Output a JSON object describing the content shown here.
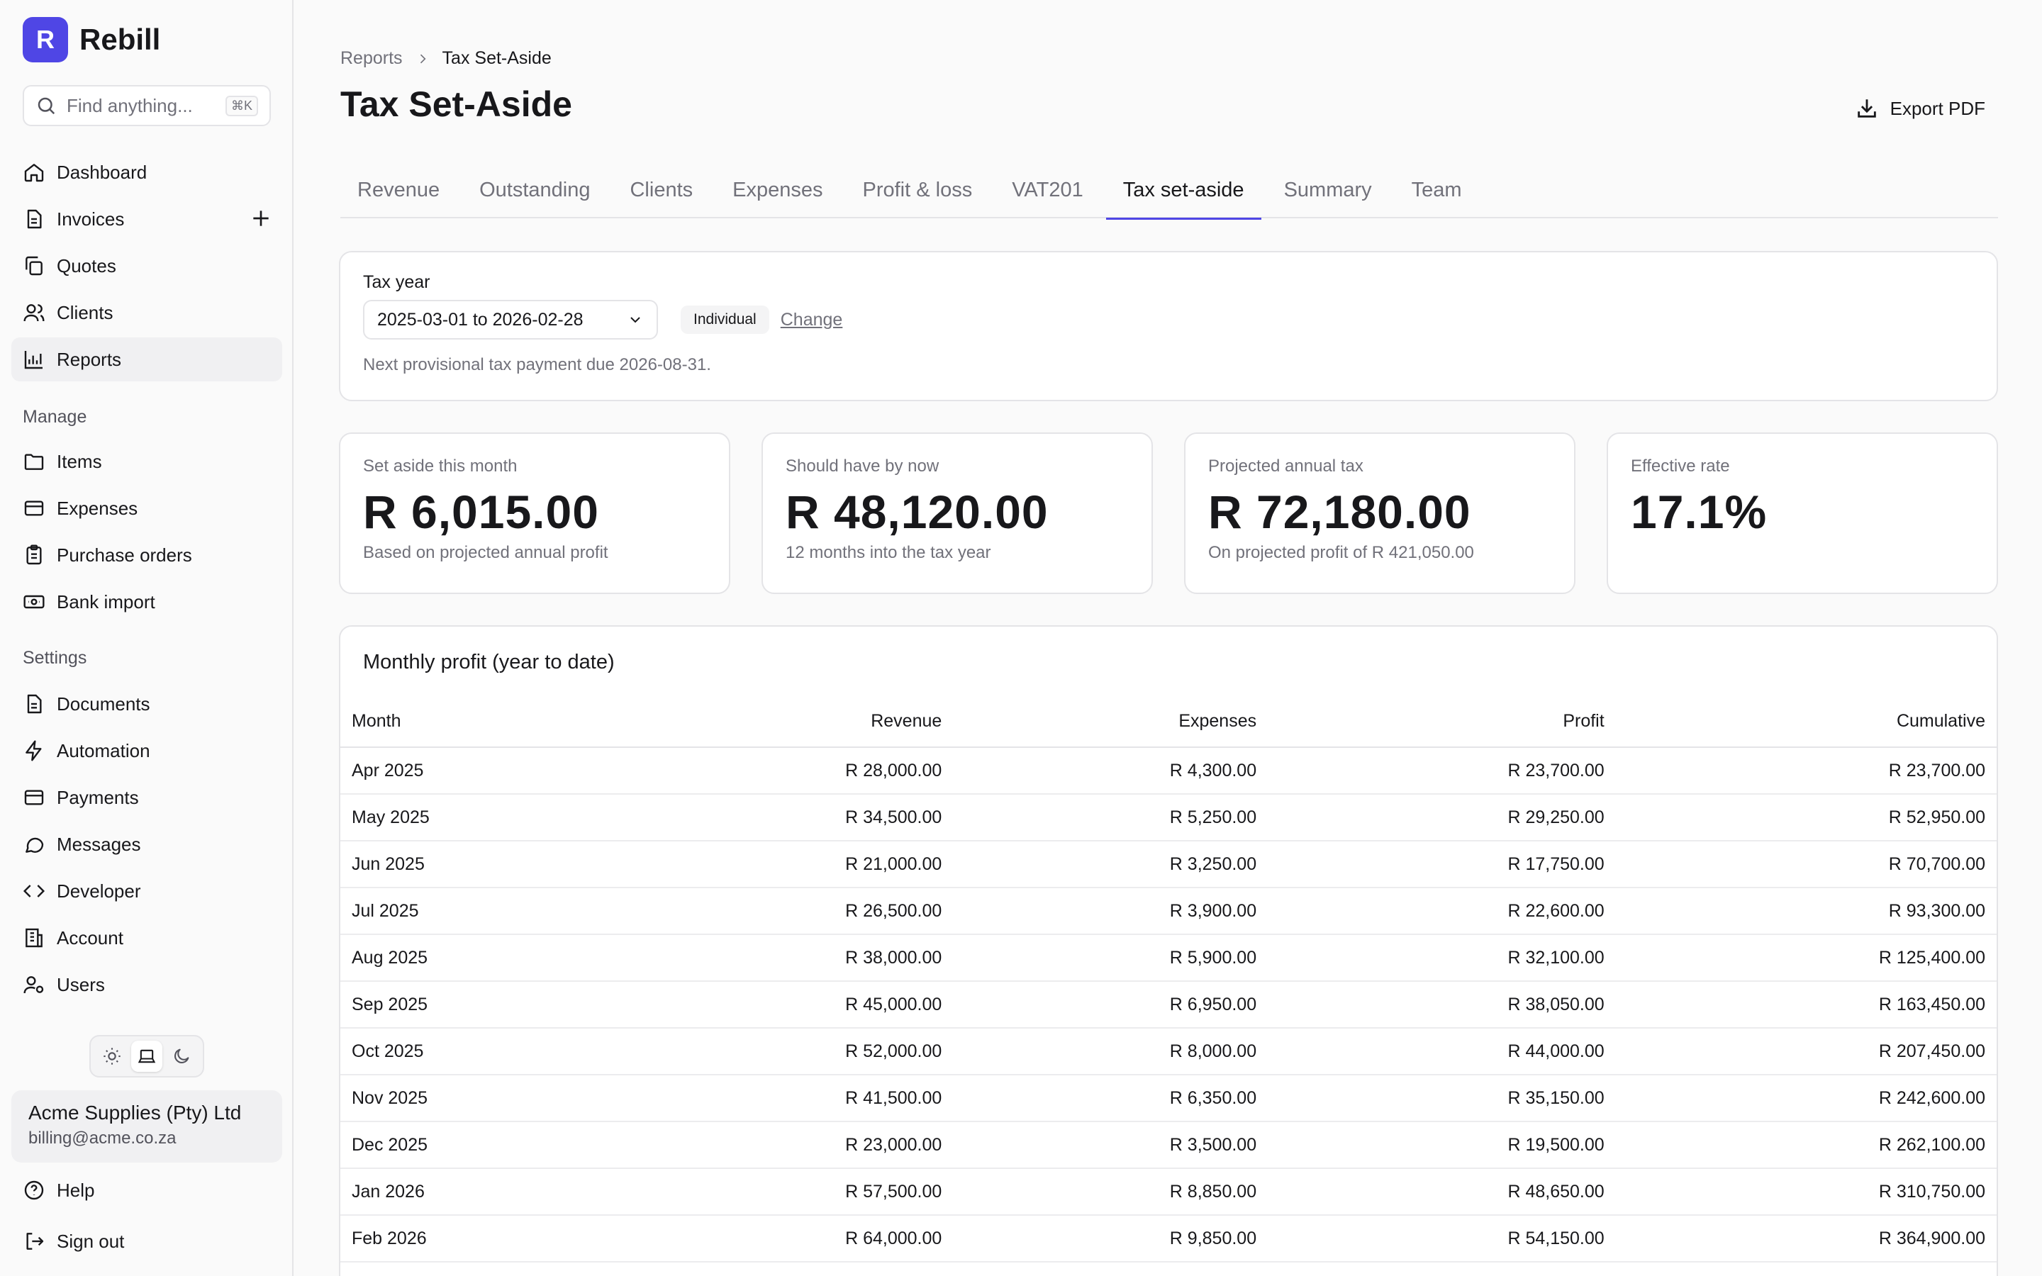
{
  "brand": {
    "letter": "R",
    "name": "Rebill"
  },
  "search": {
    "placeholder": "Find anything...",
    "shortcut": "⌘K"
  },
  "nav": {
    "dashboard": "Dashboard",
    "invoices": "Invoices",
    "quotes": "Quotes",
    "clients": "Clients",
    "reports": "Reports"
  },
  "manage": {
    "label": "Manage",
    "items": "Items",
    "expenses": "Expenses",
    "purchase_orders": "Purchase orders",
    "bank_import": "Bank import"
  },
  "settings": {
    "label": "Settings",
    "documents": "Documents",
    "automation": "Automation",
    "payments": "Payments",
    "messages": "Messages",
    "developer": "Developer",
    "account": "Account",
    "users": "Users"
  },
  "account_card": {
    "name": "Acme Supplies (Pty) Ltd",
    "email": "billing@acme.co.za"
  },
  "footer": {
    "help": "Help",
    "sign_out": "Sign out"
  },
  "breadcrumb": {
    "parent": "Reports",
    "current": "Tax Set-Aside"
  },
  "page": {
    "title": "Tax Set-Aside",
    "export": "Export PDF"
  },
  "tabs": [
    "Revenue",
    "Outstanding",
    "Clients",
    "Expenses",
    "Profit & loss",
    "VAT201",
    "Tax set-aside",
    "Summary",
    "Team"
  ],
  "active_tab": "Tax set-aside",
  "tax_year": {
    "label": "Tax year",
    "value": "2025-03-01 to 2026-02-28",
    "badge": "Individual",
    "change": "Change",
    "note": "Next provisional tax payment due 2026-08-31."
  },
  "kpis": [
    {
      "label": "Set aside this month",
      "value": "R 6,015.00",
      "sub": "Based on projected annual profit"
    },
    {
      "label": "Should have by now",
      "value": "R 48,120.00",
      "sub": "12 months into the tax year"
    },
    {
      "label": "Projected annual tax",
      "value": "R 72,180.00",
      "sub": "On projected profit of R 421,050.00"
    },
    {
      "label": "Effective rate",
      "value": "17.1%",
      "sub": ""
    }
  ],
  "table": {
    "title": "Monthly profit (year to date)",
    "columns": [
      "Month",
      "Revenue",
      "Expenses",
      "Profit",
      "Cumulative"
    ],
    "rows": [
      [
        "Apr 2025",
        "R 28,000.00",
        "R 4,300.00",
        "R 23,700.00",
        "R 23,700.00"
      ],
      [
        "May 2025",
        "R 34,500.00",
        "R 5,250.00",
        "R 29,250.00",
        "R 52,950.00"
      ],
      [
        "Jun 2025",
        "R 21,000.00",
        "R 3,250.00",
        "R 17,750.00",
        "R 70,700.00"
      ],
      [
        "Jul 2025",
        "R 26,500.00",
        "R 3,900.00",
        "R 22,600.00",
        "R 93,300.00"
      ],
      [
        "Aug 2025",
        "R 38,000.00",
        "R 5,900.00",
        "R 32,100.00",
        "R 125,400.00"
      ],
      [
        "Sep 2025",
        "R 45,000.00",
        "R 6,950.00",
        "R 38,050.00",
        "R 163,450.00"
      ],
      [
        "Oct 2025",
        "R 52,000.00",
        "R 8,000.00",
        "R 44,000.00",
        "R 207,450.00"
      ],
      [
        "Nov 2025",
        "R 41,500.00",
        "R 6,350.00",
        "R 35,150.00",
        "R 242,600.00"
      ],
      [
        "Dec 2025",
        "R 23,000.00",
        "R 3,500.00",
        "R 19,500.00",
        "R 262,100.00"
      ],
      [
        "Jan 2026",
        "R 57,500.00",
        "R 8,850.00",
        "R 48,650.00",
        "R 310,750.00"
      ],
      [
        "Feb 2026",
        "R 64,000.00",
        "R 9,850.00",
        "R 54,150.00",
        "R 364,900.00"
      ]
    ]
  },
  "colors": {
    "accent": "#4f46e5",
    "border": "#e4e4e7",
    "muted": "#71717a"
  }
}
